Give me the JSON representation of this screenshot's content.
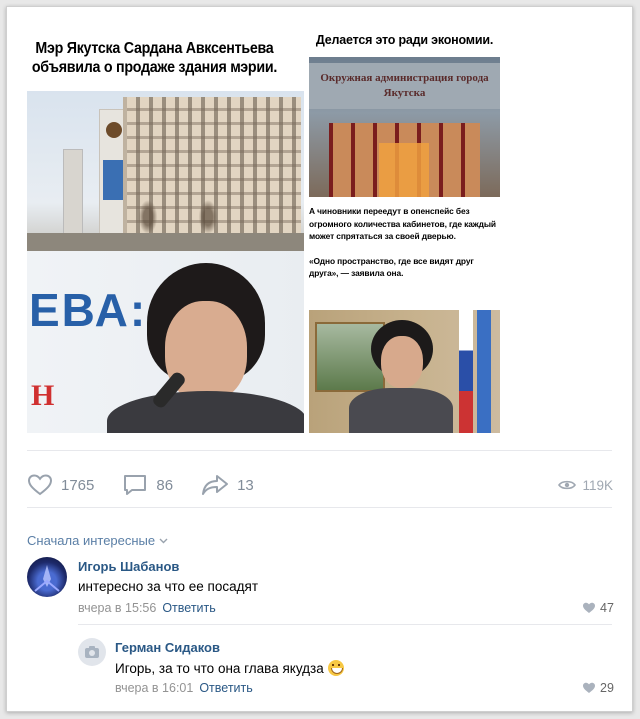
{
  "post": {
    "image": {
      "headline_left": "Мэр Якутска Сардана Авксентьева объявила о продаже здания мэрии.",
      "headline_right": "Делается это ради экономии.",
      "door_sign": "Окружная администрация города Якутска",
      "slogan": "ЕВА:",
      "slogan2": "Н",
      "caption_1": "А чиновники переедут в опенспейс без огромного количества кабинетов, где каждый может спрятаться за своей дверью.",
      "caption_2": "«Одно пространство, где все видят друг друга», — заявила она."
    },
    "actions": {
      "likes": "1765",
      "comments": "86",
      "shares": "13",
      "views": "119K"
    },
    "sort_label": "Сначала интересные"
  },
  "comments": [
    {
      "author": "Игорь Шабанов",
      "text": "интересно за что ее посадят",
      "time": "вчера в 15:56",
      "reply": "Ответить",
      "likes": "47"
    },
    {
      "author": "Герман Сидаков",
      "text": "Игорь, за то что она глава якудза",
      "time": "вчера в 16:01",
      "reply": "Ответить",
      "likes": "29"
    }
  ],
  "colors": {
    "link": "#2a5885",
    "muted": "#818c99",
    "icon": "#99a2ad"
  }
}
